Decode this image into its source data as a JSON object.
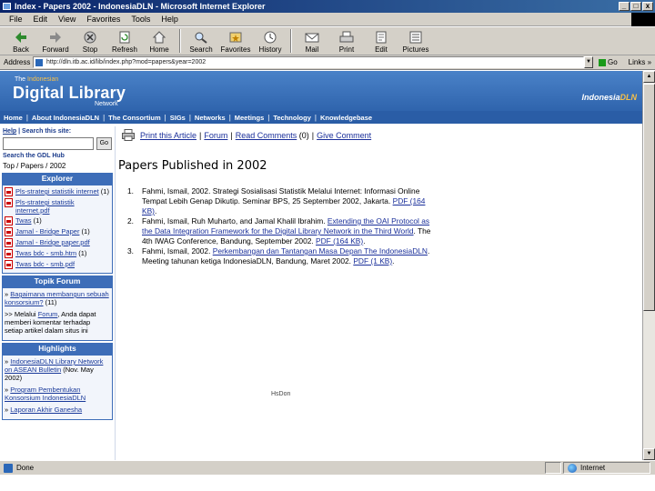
{
  "window": {
    "title": "Index - Papers 2002 - IndonesiaDLN - Microsoft Internet Explorer",
    "btn_min": "_",
    "btn_max": "□",
    "btn_close": "x"
  },
  "menubar": [
    "File",
    "Edit",
    "View",
    "Favorites",
    "Tools",
    "Help"
  ],
  "toolbar": [
    {
      "label": "Back",
      "icon": "back-arrow-icon"
    },
    {
      "label": "Forward",
      "icon": "forward-arrow-icon"
    },
    {
      "label": "Stop",
      "icon": "stop-icon"
    },
    {
      "label": "Refresh",
      "icon": "refresh-icon"
    },
    {
      "label": "Home",
      "icon": "home-icon"
    },
    {
      "label": "Search",
      "icon": "search-icon"
    },
    {
      "label": "Favorites",
      "icon": "favorites-icon"
    },
    {
      "label": "History",
      "icon": "history-icon"
    },
    {
      "label": "Mail",
      "icon": "mail-icon"
    },
    {
      "label": "Print",
      "icon": "print-icon"
    },
    {
      "label": "Edit",
      "icon": "edit-icon"
    },
    {
      "label": "Pictures",
      "icon": "pictures-icon"
    }
  ],
  "address": {
    "label": "Address",
    "url": "http://dln.itb.ac.id/lib/index.php?mod=papers&year=2002",
    "go_label": "Go",
    "links_label": "Links »"
  },
  "banner": {
    "the_prefix": "The",
    "the_suffix": "Indonesian",
    "title": "Digital Library",
    "network": "Network",
    "logo_prefix": "Indonesia",
    "logo_suffix": "DLN"
  },
  "nav": [
    "Home",
    "About IndonesiaDLN",
    "The Consortium",
    "SIGs",
    "Networks",
    "Meetings",
    "Technology",
    "Knowledgebase"
  ],
  "left": {
    "help_label": "Help",
    "search_site_label": "Search this site:",
    "search_button": "Go",
    "search_gdl": "Search the GDL Hub",
    "breadcrumb": "Top / Papers / 2002",
    "explorer_title": "Explorer",
    "explorer_items": [
      {
        "name": "Pls-strategi statistik internet",
        "count": "(1)"
      },
      {
        "name": "Pls-strategi statistik internet.pdf",
        "count": ""
      },
      {
        "name": "Twas",
        "count": "(1)"
      },
      {
        "name": "Jamal - Bridge Paper",
        "count": "(1)"
      },
      {
        "name": "Jamal - Bridge paper.pdf",
        "count": ""
      },
      {
        "name": "Twas bdc - smb.htm",
        "count": "(1)"
      },
      {
        "name": "Twas bdc - smb.pdf",
        "count": ""
      }
    ],
    "forum_title": "Topik Forum",
    "forum_items": [
      {
        "pre": "» ",
        "link": "Bagaimana membangun sebuah konsorsium?",
        "post": " (11)"
      },
      {
        "pre": ">> Melalui ",
        "link": "Forum",
        "post": ", Anda dapat memberi komentar terhadap setiap artikel dalam situs ini"
      }
    ],
    "highlights_title": "Highlights",
    "highlight_items": [
      {
        "pre": "» ",
        "link": "IndonesiaDLN Library Network on ASEAN Bulletin",
        "post": " (Nov. May 2002)"
      },
      {
        "pre": "» ",
        "link": "Program Pembentukan Konsorsium IndonesiaDLN",
        "post": ""
      },
      {
        "pre": "» ",
        "link": "Laporan Akhir Ganesha",
        "post": ""
      }
    ]
  },
  "main": {
    "actions": [
      "Print this Article",
      "Forum",
      "Read Comments",
      "Give Comment"
    ],
    "comments_count": "(0)",
    "page_title": "Papers Published in 2002",
    "papers": [
      {
        "num": "1.",
        "text": "Fahmi, Ismail, 2002. Strategi Sosialisasi Statistik Melalui Internet: Informasi Online Tempat Lebih Genap Dikutip. Seminar BPS, 25 September 2002, Jakarta. ",
        "link": "PDF (164 KB)",
        "end": "."
      },
      {
        "num": "2.",
        "text": "Fahmi, Ismail, Ruh Muharto, and Jamal Khalil Ibrahim. ",
        "link": "Extending the OAI Protocol as the Data Integration Framework for the Digital Library Network in the Third World",
        "end": ". The 4th IWAG Conference, Bandung, September 2002. ",
        "link2": "PDF (164 KB)",
        "end2": "."
      },
      {
        "num": "3.",
        "text": "Fahmi, Ismail, 2002. ",
        "link": "Perkembangan dan Tantangan Masa Depan The IndonesiaDLN",
        "end": ". Meeting tahunan ketiga IndonesiaDLN, Bandung, Maret 2002. ",
        "link2": "PDF (1 KB)",
        "end2": "."
      }
    ],
    "footer_mark": "HsDon"
  },
  "status": {
    "text": "Done",
    "zone": "Internet"
  }
}
